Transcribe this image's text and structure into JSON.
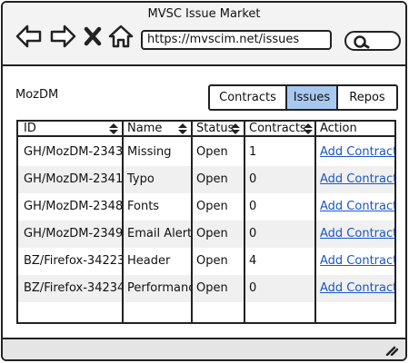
{
  "window": {
    "title": "MVSC Issue Market"
  },
  "toolbar": {
    "back_icon": "back-arrow-icon",
    "forward_icon": "forward-arrow-icon",
    "stop_icon": "close-icon",
    "home_icon": "home-icon",
    "url": "https://mvscim.net/issues",
    "search_icon": "search-icon"
  },
  "brand": "MozDM",
  "tabs": [
    {
      "label": "Contracts",
      "active": false
    },
    {
      "label": "Issues",
      "active": true
    },
    {
      "label": "Repos",
      "active": false
    }
  ],
  "table": {
    "columns": [
      "ID",
      "Name",
      "Status",
      "Contracts",
      "Action"
    ],
    "rows": [
      {
        "id": "GH/MozDM-2343",
        "name": "Missing",
        "status": "Open",
        "contracts": "1",
        "action": "Add Contract"
      },
      {
        "id": "GH/MozDM-2341",
        "name": "Typo",
        "status": "Open",
        "contracts": "0",
        "action": "Add Contract"
      },
      {
        "id": "GH/MozDM-2348",
        "name": "Fonts",
        "status": "Open",
        "contracts": "0",
        "action": "Add Contract"
      },
      {
        "id": "GH/MozDM-2349",
        "name": "Email Alert",
        "status": "Open",
        "contracts": "0",
        "action": "Add Contract"
      },
      {
        "id": "BZ/Firefox-34223",
        "name": "Header",
        "status": "Open",
        "contracts": "4",
        "action": "Add Contract"
      },
      {
        "id": "BZ/Firefox-34234",
        "name": "Performance",
        "status": "Open",
        "contracts": "0",
        "action": "Add Contract"
      }
    ]
  },
  "colors": {
    "active_tab": "#a8c8f0",
    "link": "#1a56c8",
    "alt_row": "#f0f0f0"
  }
}
